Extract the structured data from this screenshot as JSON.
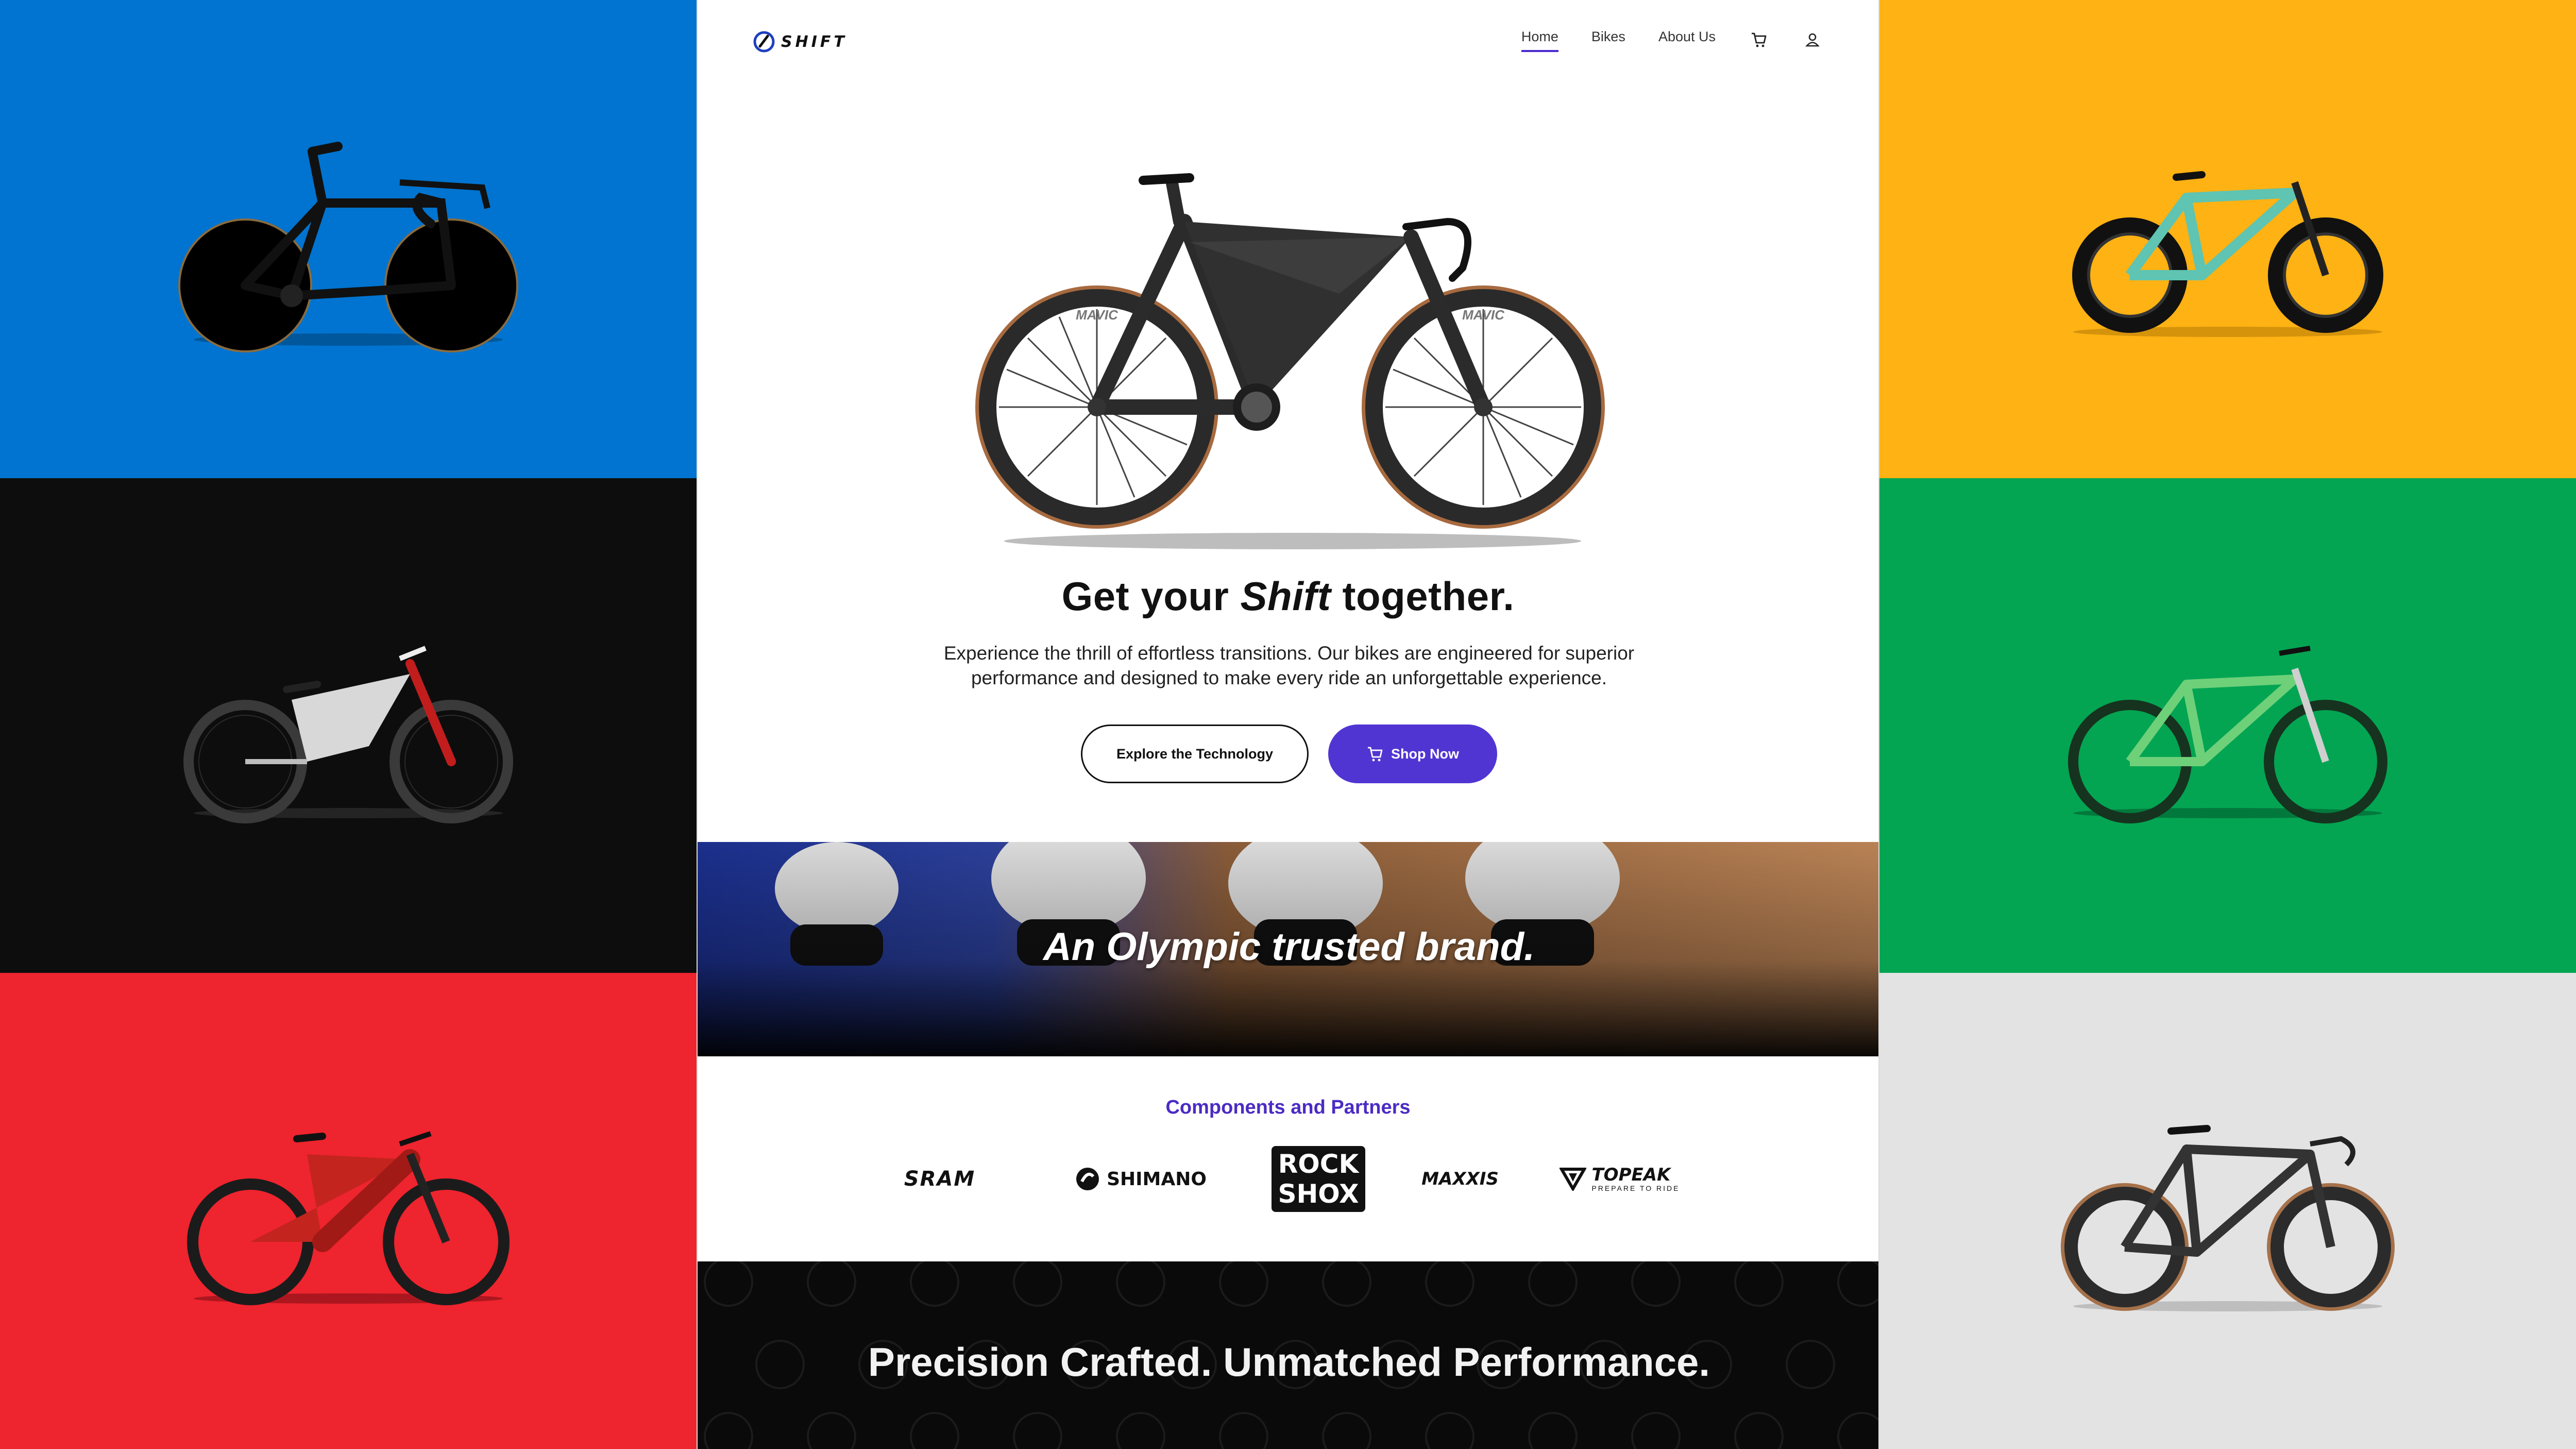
{
  "colors": {
    "blue": "#0074d0",
    "black": "#0d0d0d",
    "red": "#ee242e",
    "yellow": "#feb213",
    "green": "#03a552",
    "gray": "#e3e3e3",
    "accent": "#5135d3"
  },
  "side_panels": [
    {
      "name": "blue-panel",
      "bike": "track-bike"
    },
    {
      "name": "black-panel",
      "bike": "downhill-bike"
    },
    {
      "name": "red-panel",
      "bike": "e-mtb-bike"
    },
    {
      "name": "yellow-panel",
      "bike": "fat-bike"
    },
    {
      "name": "green-panel",
      "bike": "dirt-jump-bike"
    },
    {
      "name": "gray-panel",
      "bike": "road-bike"
    }
  ],
  "brand": {
    "name": "SHIFT"
  },
  "nav": {
    "home": "Home",
    "bikes": "Bikes",
    "about": "About Us",
    "cart_icon": "cart-icon",
    "account_icon": "user-icon"
  },
  "hero": {
    "headline_prefix": "Get your ",
    "headline_emphasis": "Shift",
    "headline_suffix": " together.",
    "subtext": "Experience the thrill of effortless transitions. Our bikes are engineered for superior performance and designed to make every ride an unforgettable experience.",
    "tire_brand": "MAVIC",
    "explore_button": "Explore the Technology",
    "shop_button": "Shop Now"
  },
  "olympic": {
    "tagline": "An Olympic trusted brand."
  },
  "partners": {
    "title": "Components and Partners",
    "sram": "SRAM",
    "shimano": "SHIMANO",
    "rockshox_top": "ROCK",
    "rockshox_bottom": "SHOX",
    "maxxis": "MAXXIS",
    "topeak": "TOPEAK",
    "topeak_tagline": "PREPARE TO RIDE"
  },
  "footer": {
    "tagline": "Precision Crafted. Unmatched Performance."
  }
}
